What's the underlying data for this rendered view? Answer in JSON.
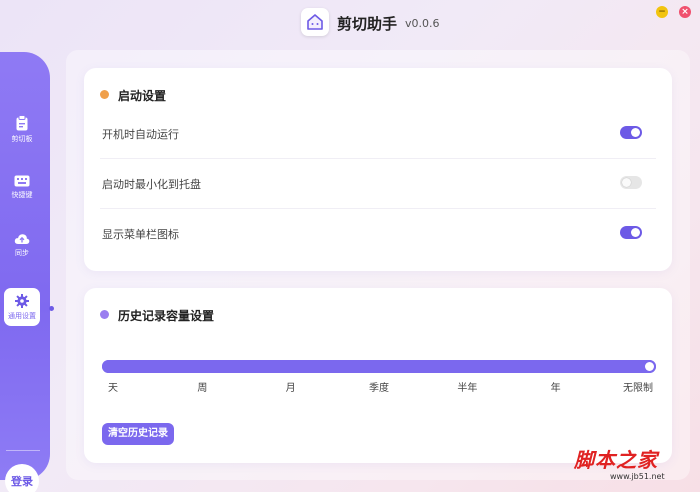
{
  "window": {
    "title": "剪切助手",
    "version": "v0.0.6",
    "minimize_glyph": "−",
    "close_glyph": "×",
    "logo_icon": "house-icon"
  },
  "sidebar": {
    "items": [
      {
        "label": "剪切板",
        "icon": "clipboard-icon"
      },
      {
        "label": "快捷键",
        "icon": "keyboard-icon"
      },
      {
        "label": "同步",
        "icon": "cloud-upload-icon"
      },
      {
        "label": "通用设置",
        "icon": "gear-icon",
        "active": true
      }
    ],
    "login_label": "登录"
  },
  "startup": {
    "title": "启动设置",
    "dot_color": "#f0a04b",
    "rows": [
      {
        "label": "开机时自动运行",
        "on": true
      },
      {
        "label": "启动时最小化到托盘",
        "on": false
      },
      {
        "label": "显示菜单栏图标",
        "on": true
      }
    ]
  },
  "history": {
    "title": "历史记录容量设置",
    "dot_color": "#9b7ef0",
    "ticks": [
      "天",
      "周",
      "月",
      "季度",
      "半年",
      "年",
      "无限制"
    ],
    "selected_index": 6,
    "clear_label": "清空历史记录"
  },
  "colors": {
    "accent": "#7b68ee",
    "toggle_off": "#e6e6e6"
  },
  "watermark": {
    "main": "脚本之家",
    "sub": "www.jb51.net"
  }
}
